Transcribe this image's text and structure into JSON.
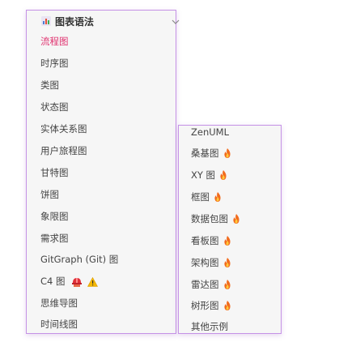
{
  "main_menu": {
    "header": "图表语法",
    "items": [
      {
        "label": "流程图",
        "active": true
      },
      {
        "label": "时序图"
      },
      {
        "label": "类图"
      },
      {
        "label": "状态图"
      },
      {
        "label": "实体关系图"
      },
      {
        "label": "用户旅程图"
      },
      {
        "label": "甘特图"
      },
      {
        "label": "饼图"
      },
      {
        "label": "象限图"
      },
      {
        "label": "需求图"
      },
      {
        "label": "GitGraph (Git) 图"
      },
      {
        "label": "C4 图"
      },
      {
        "label": "思维导图"
      },
      {
        "label": "时间线图"
      }
    ]
  },
  "submenu": {
    "items": [
      {
        "label": "ZenUML",
        "icon": "none"
      },
      {
        "label": "桑基图",
        "icon": "fire-icon"
      },
      {
        "label": "XY 图",
        "icon": "fire-icon"
      },
      {
        "label": "框图",
        "icon": "fire-icon"
      },
      {
        "label": "数据包图",
        "icon": "fire-icon"
      },
      {
        "label": "看板图",
        "icon": "fire-icon"
      },
      {
        "label": "架构图",
        "icon": "fire-icon"
      },
      {
        "label": "雷达图",
        "icon": "fire-icon"
      },
      {
        "label": "树形图",
        "icon": "fire-icon"
      },
      {
        "label": "其他示例",
        "icon": "none"
      }
    ]
  },
  "colors": {
    "active": "#e0306e",
    "border": "#c592e6",
    "background": "#f6f6f6",
    "text": "#444444"
  }
}
